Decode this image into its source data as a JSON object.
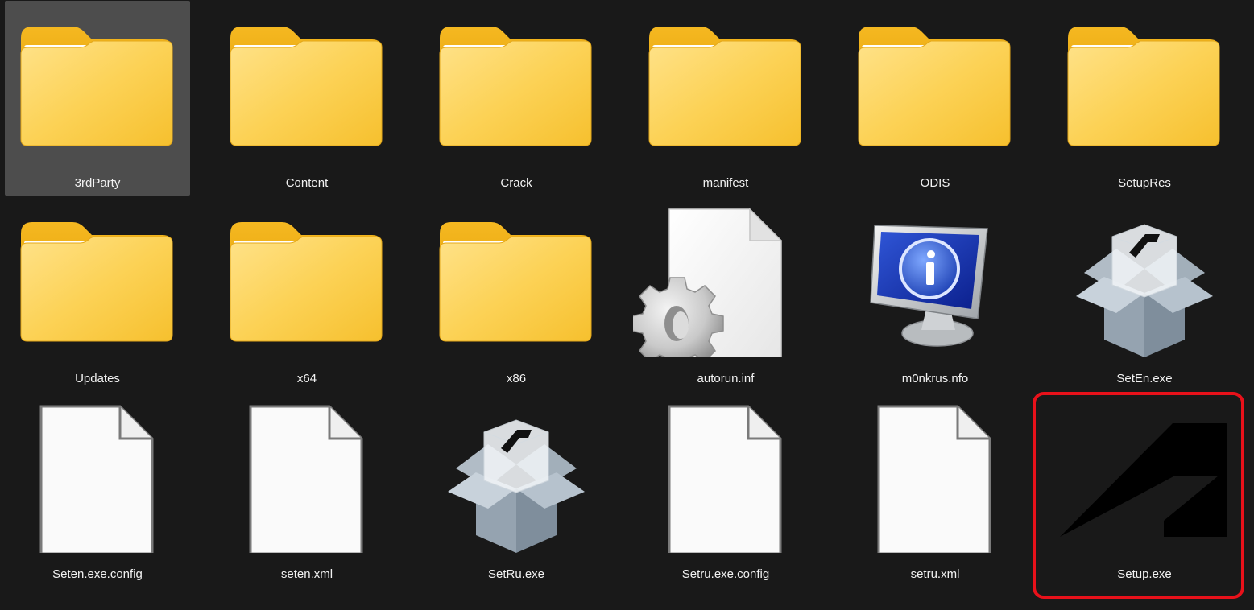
{
  "colors": {
    "background": "#191919",
    "selection": "#4d4d4d",
    "highlight_border": "#e8111a",
    "folder_yellow": "#f8c73d"
  },
  "items": [
    {
      "name": "3rdParty",
      "icon": "folder-icon",
      "selected": true
    },
    {
      "name": "Content",
      "icon": "folder-icon"
    },
    {
      "name": "Crack",
      "icon": "folder-icon"
    },
    {
      "name": "manifest",
      "icon": "folder-icon"
    },
    {
      "name": "ODIS",
      "icon": "folder-icon"
    },
    {
      "name": "SetupRes",
      "icon": "folder-icon"
    },
    {
      "name": "Updates",
      "icon": "folder-icon"
    },
    {
      "name": "x64",
      "icon": "folder-icon"
    },
    {
      "name": "x86",
      "icon": "folder-icon"
    },
    {
      "name": "autorun.inf",
      "icon": "settings-file-icon"
    },
    {
      "name": "m0nkrus.nfo",
      "icon": "info-monitor-icon"
    },
    {
      "name": "SetEn.exe",
      "icon": "installer-box-icon"
    },
    {
      "name": "Seten.exe.config",
      "icon": "blank-file-icon"
    },
    {
      "name": "seten.xml",
      "icon": "blank-file-icon"
    },
    {
      "name": "SetRu.exe",
      "icon": "installer-box-icon"
    },
    {
      "name": "Setru.exe.config",
      "icon": "blank-file-icon"
    },
    {
      "name": "setru.xml",
      "icon": "blank-file-icon"
    },
    {
      "name": "Setup.exe",
      "icon": "autodesk-logo-icon",
      "highlighted": true
    }
  ]
}
